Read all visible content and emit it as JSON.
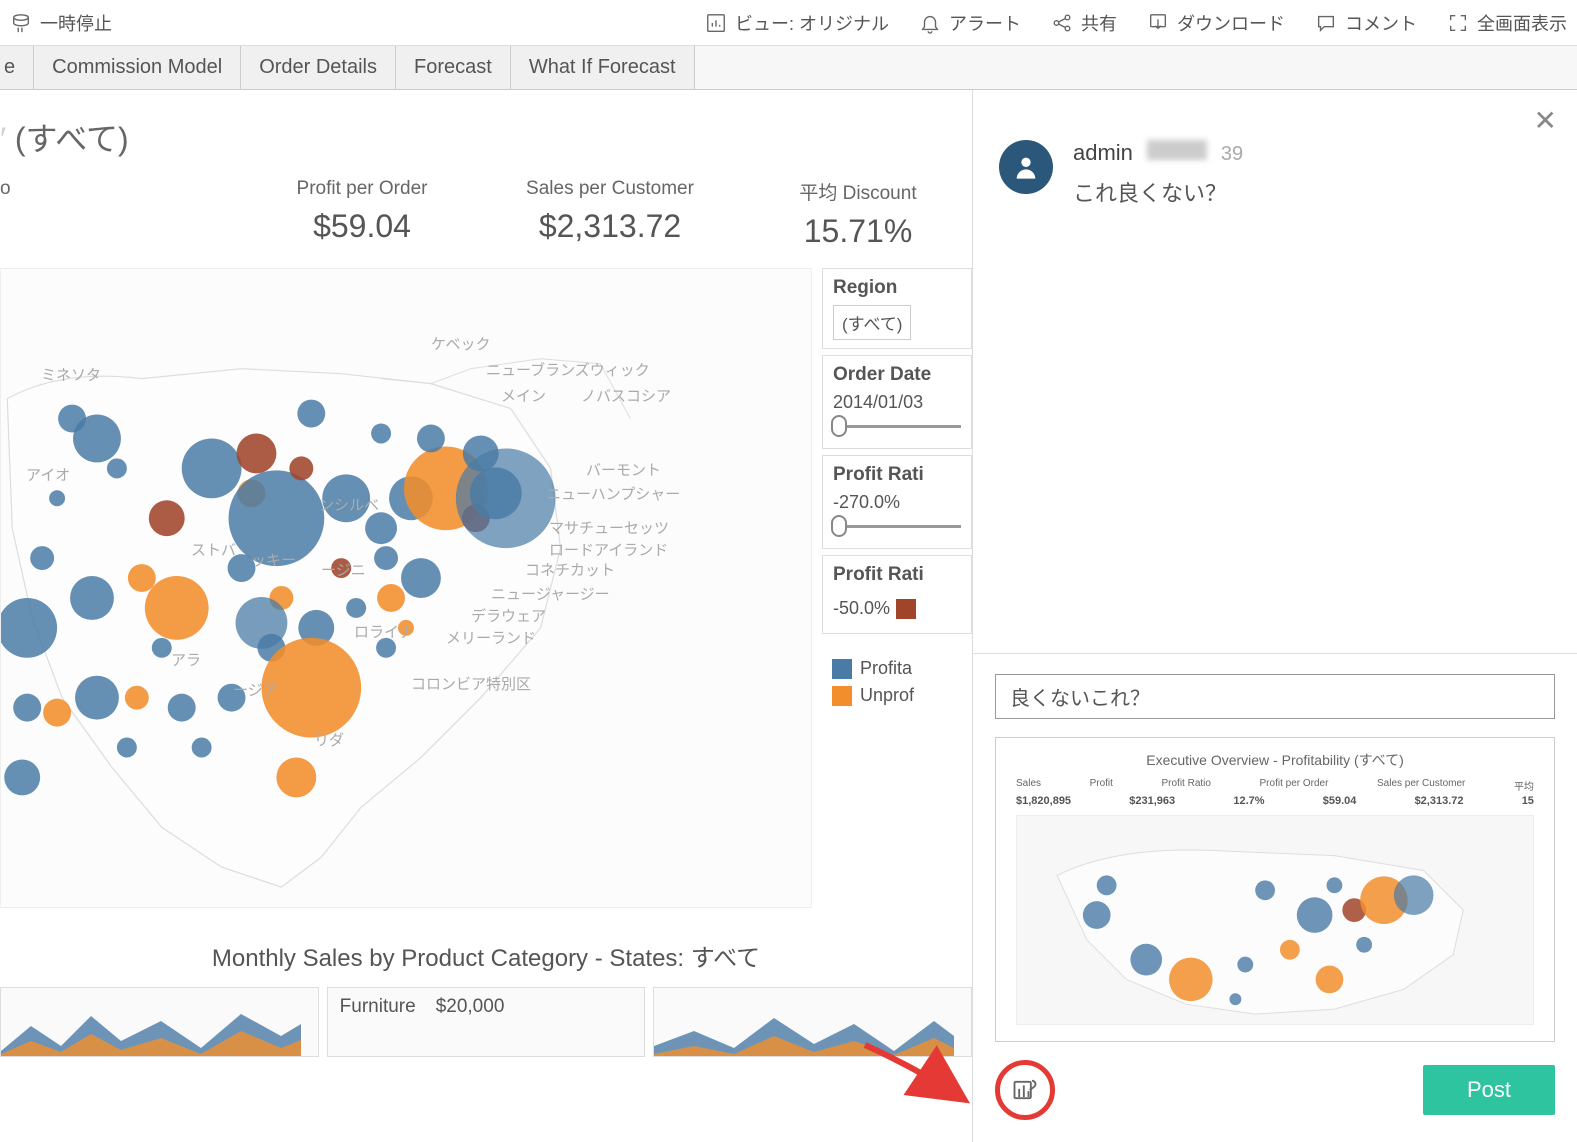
{
  "toolbar": {
    "pause": "一時停止",
    "view": "ビュー: オリジナル",
    "alert": "アラート",
    "share": "共有",
    "download": "ダウンロード",
    "comment": "コメント",
    "fullscreen": "全画面表示"
  },
  "tabs": [
    "e",
    "Commission Model",
    "Order Details",
    "Forecast",
    "What If Forecast"
  ],
  "dashboard": {
    "title_suffix": "(すべて)",
    "kpis": [
      {
        "label": "o",
        "value": ""
      },
      {
        "label": "Profit per Order",
        "value": "$59.04"
      },
      {
        "label": "Sales per Customer",
        "value": "$2,313.72"
      },
      {
        "label": "平均 Discount",
        "value": "15.71%"
      }
    ],
    "filters": {
      "region_label": "Region",
      "region_value": "(すべて)",
      "order_date_label": "Order Date",
      "order_date_value": "2014/01/03",
      "profit_ratio_label": "Profit Rati",
      "profit_ratio_value": "-270.0%",
      "profit_ratio2_label": "Profit Rati",
      "profit_ratio2_value": "-50.0%",
      "legend_profitable": "Profita",
      "legend_unprofitable": "Unprof"
    },
    "map_labels": {
      "minnesota": "ミネソタ",
      "iowa": "アイオ",
      "new_brunswick": "ニューブランズウィック",
      "maine": "メイン",
      "nova_scotia": "ノバスコシア",
      "quebec": "ケベック",
      "vermont": "バーモント",
      "new_hampshire": "ニューハンプシャー",
      "massachusetts": "マサチューセッツ",
      "rhode_island": "ロードアイランド",
      "connecticut": "コネチカット",
      "new_jersey": "ニュージャージー",
      "delaware": "デラウェア",
      "maryland": "メリーランド",
      "pennsylvania": "ンシルベ",
      "virginia": "ージニ",
      "carolina": "ロライナ",
      "georgia": "ージア",
      "washington_dc": "コロンビア特別区",
      "florida": "リダ",
      "kentucky": "ッキー",
      "arkansas": "アラ",
      "tennessee": "ストバ"
    },
    "monthly_title": "Monthly Sales by Product Category - States: すべて",
    "monthly": [
      {
        "label": "",
        "value": ""
      },
      {
        "label": "Furniture",
        "value": "$20,000"
      },
      {
        "label": "",
        "value": ""
      }
    ]
  },
  "comments": {
    "author": "admin",
    "time_suffix": "39",
    "text": "これ良くない？",
    "compose_value": "良くないこれ？",
    "post_label": "Post",
    "snapshot": {
      "title": "Executive Overview - Profitability (すべて)",
      "kpi_labels": [
        "Sales",
        "Profit",
        "Profit Ratio",
        "Profit per Order",
        "Sales per Customer",
        "平均"
      ],
      "kpi_values": [
        "$1,820,895",
        "$231,963",
        "12.7%",
        "$59.04",
        "$2,313.72",
        "15"
      ]
    }
  },
  "chart_data": {
    "type": "scatter",
    "note": "US map bubble chart; bubble size = sales, color = profitability",
    "series": [
      {
        "name": "Profitable",
        "color": "#4a7ba6"
      },
      {
        "name": "Unprofitable",
        "color": "#f28e2b"
      }
    ],
    "profit_ratio_range": [
      -270.0,
      0
    ],
    "profit_ratio_color_range": [
      -50.0,
      0
    ],
    "region_filter": "(すべて)",
    "order_date_start": "2014/01/03"
  }
}
